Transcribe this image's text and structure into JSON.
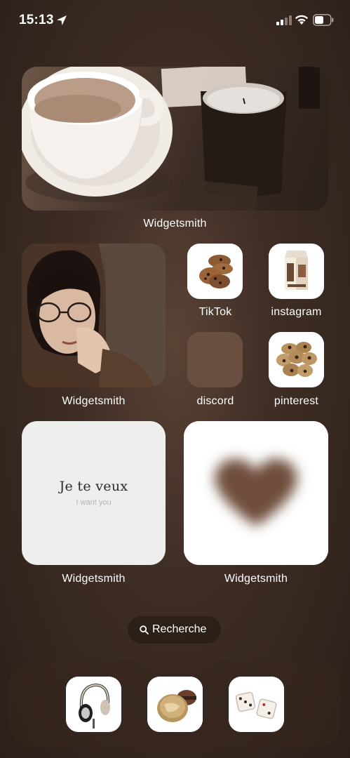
{
  "status_bar": {
    "time": "15:13",
    "icons": [
      "location-arrow-icon",
      "cellular-signal-icon",
      "wifi-icon",
      "battery-icon"
    ]
  },
  "home": {
    "widgets": [
      {
        "label": "Widgetsmith",
        "content": "coffee-and-candle-photo"
      },
      {
        "label": "Widgetsmith",
        "content": "portrait-photo"
      },
      {
        "label": "Widgetsmith",
        "title": "Je te veux",
        "subtitle": "I want you"
      },
      {
        "label": "Widgetsmith",
        "content": "brown-heart-image"
      }
    ],
    "apps": [
      {
        "label": "TikTok",
        "icon": "cookies-icon"
      },
      {
        "label": "instagram",
        "icon": "milk-carton-icon"
      },
      {
        "label": "discord",
        "icon": "brown-square-icon"
      },
      {
        "label": "pinterest",
        "icon": "cookie-pile-icon"
      }
    ]
  },
  "search": {
    "label": "Recherche",
    "icon": "search-icon"
  },
  "dock": {
    "apps": [
      {
        "icon": "headphones-icon"
      },
      {
        "icon": "macarons-icon"
      },
      {
        "icon": "dice-icon"
      }
    ]
  },
  "colors": {
    "background": "#3f2e25",
    "discord_tile": "#6a4e40",
    "heart": "#6e4e3a"
  }
}
